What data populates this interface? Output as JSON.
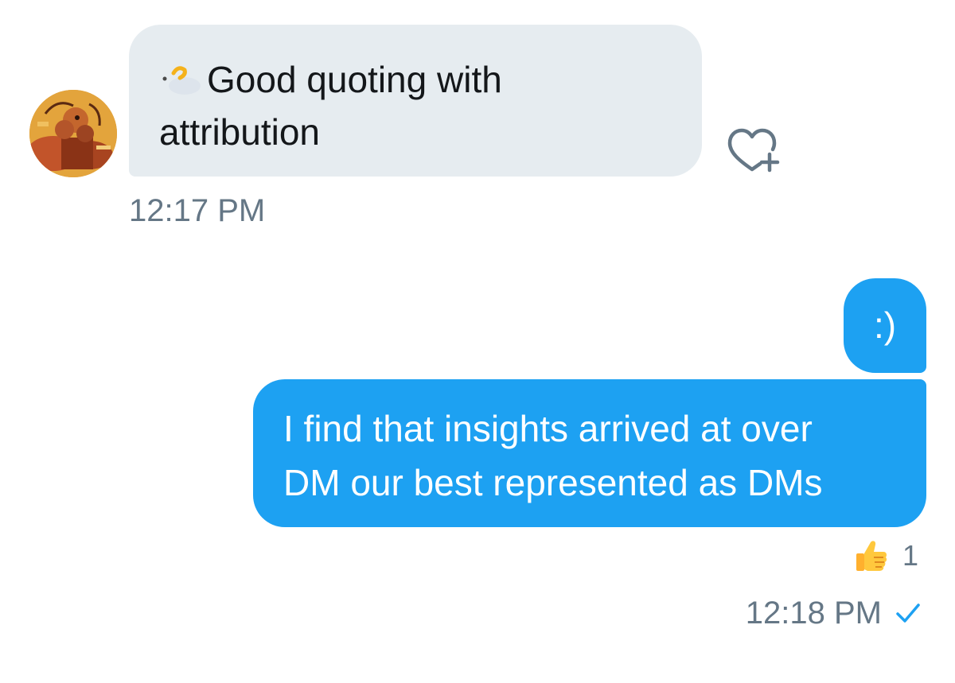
{
  "conversation": {
    "incoming": {
      "avatar_icon": "caterpillar-illustration-avatar",
      "emoji_icon": "speech-bubble-emoji",
      "text_line1": "Good quoting with",
      "text_line2": "attribution",
      "timestamp": "12:17 PM",
      "react_icon": "heart-plus-icon"
    },
    "outgoing": {
      "message1": ":)",
      "message2_line1": "I find that insights arrived at over",
      "message2_line2": "DM our best represented as DMs",
      "reaction_icon": "thumbs-up-emoji",
      "reaction_count": "1",
      "timestamp": "12:18 PM",
      "status_icon": "checkmark-icon"
    }
  },
  "colors": {
    "incoming_bubble": "#e6ecf0",
    "outgoing_bubble": "#1da1f2",
    "timestamp_text": "#657786",
    "accent": "#1da1f2"
  }
}
